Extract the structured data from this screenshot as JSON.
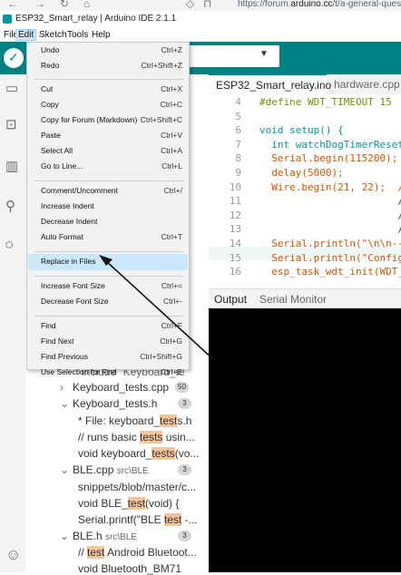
{
  "browser": {
    "url_prefix": "https://forum.",
    "url_domain": "arduino.cc",
    "url_rest": "/t/a-general-question-a"
  },
  "window": {
    "title": "ESP32_Smart_relay | Arduino IDE 2.1.1"
  },
  "menubar": {
    "items": [
      "File",
      "Edit",
      "Sketch",
      "Tools",
      "Help"
    ]
  },
  "edit_menu": {
    "items": [
      {
        "label": "Undo",
        "shortcut": "Ctrl+Z"
      },
      {
        "label": "Redo",
        "shortcut": "Ctrl+Shift+Z"
      },
      {
        "label": "Cut",
        "shortcut": "Ctrl+X"
      },
      {
        "label": "Copy",
        "shortcut": "Ctrl+C"
      },
      {
        "label": "Copy for Forum (Markdown)",
        "shortcut": "Ctrl+Shift+C"
      },
      {
        "label": "Paste",
        "shortcut": "Ctrl+V"
      },
      {
        "label": "Select All",
        "shortcut": "Ctrl+A"
      },
      {
        "label": "Go to Line...",
        "shortcut": "Ctrl+L"
      },
      {
        "label": "Comment/Uncomment",
        "shortcut": "Ctrl+/"
      },
      {
        "label": "Increase Indent",
        "shortcut": ""
      },
      {
        "label": "Decrease Indent",
        "shortcut": ""
      },
      {
        "label": "Auto Format",
        "shortcut": "Ctrl+T"
      },
      {
        "label": "Replace in Files",
        "shortcut": ""
      },
      {
        "label": "Increase Font Size",
        "shortcut": "Ctrl+="
      },
      {
        "label": "Decrease Font Size",
        "shortcut": "Ctrl+-"
      },
      {
        "label": "Find",
        "shortcut": "Ctrl+F"
      },
      {
        "label": "Find Next",
        "shortcut": "Ctrl+G"
      },
      {
        "label": "Find Previous",
        "shortcut": "Ctrl+Shift+G"
      },
      {
        "label": "Use Selection for Find",
        "shortcut": "Ctrl+E"
      }
    ]
  },
  "editor": {
    "tabs": [
      "ESP32_Smart_relay.ino",
      "hardware.cpp"
    ],
    "lines": [
      {
        "n": "4",
        "text": "#define WDT_TIMEOUT 15"
      },
      {
        "n": "5",
        "text": ""
      },
      {
        "n": "6",
        "text": "void setup() {"
      },
      {
        "n": "7",
        "text": "  int watchDogTimerReset"
      },
      {
        "n": "8",
        "text": "  Serial.begin(115200);"
      },
      {
        "n": "9",
        "text": "  delay(5000);"
      },
      {
        "n": "10",
        "text": "  Wire.begin(21, 22);  /"
      },
      {
        "n": "11",
        "text": "                       /"
      },
      {
        "n": "12",
        "text": "                       /"
      },
      {
        "n": "13",
        "text": "                       /"
      },
      {
        "n": "14",
        "text": "  Serial.println(\"\\n\\n--"
      },
      {
        "n": "15",
        "text": "  Serial.println(\"Config"
      },
      {
        "n": "16",
        "text": "  esp_task_wdt_init(WDT_"
      }
    ]
  },
  "output": {
    "tabs": [
      "Output",
      "Serial Monitor"
    ]
  },
  "search_results": {
    "r0": "include \"Keyboard_te",
    "f1": {
      "name": "Keyboard_tests.cpp",
      "count": "50"
    },
    "f2": {
      "name": "Keyboard_tests.h",
      "count": "3"
    },
    "m1a": "* File: keyboard_",
    "m1b": "test",
    "m1c": "s.h",
    "m2a": "// runs basic ",
    "m2b": "tests",
    "m2c": " usin...",
    "m3a": "void keyboard_",
    "m3b": "tests",
    "m3c": "(vo...",
    "f3": {
      "name": "BLE.cpp",
      "path": "src\\BLE",
      "count": "3"
    },
    "m4": "snippets/blob/master/c...",
    "m5a": "void BLE_",
    "m5b": "test",
    "m5c": "(void) {",
    "m6a": "Serial.printf(\"BLE ",
    "m6b": "test",
    "m6c": " -...",
    "f4": {
      "name": "BLE.h",
      "path": "src\\BLE",
      "count": "3"
    },
    "m7a": "// ",
    "m7b": "test",
    "m7c": " Android Bluetoot...",
    "m8": "void Bluetooth_BM71"
  }
}
